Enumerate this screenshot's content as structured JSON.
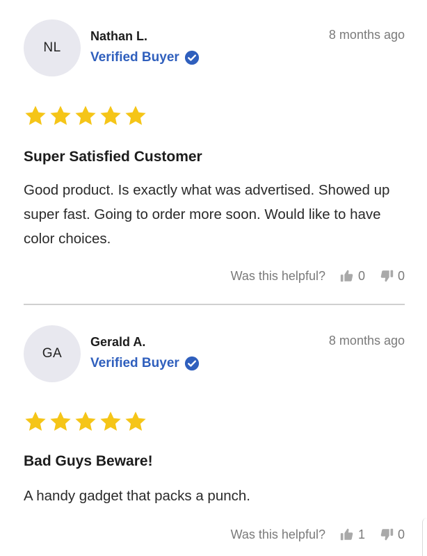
{
  "reviews": [
    {
      "initials": "NL",
      "name": "Nathan L.",
      "verified_label": "Verified Buyer",
      "time": "8 months ago",
      "rating": 5,
      "title": "Super Satisfied Customer",
      "body": "Good product. Is exactly what was advertised. Showed up super fast. Going to order more soon. Would like to have color choices.",
      "helpful_label": "Was this helpful?",
      "upvotes": "0",
      "downvotes": "0"
    },
    {
      "initials": "GA",
      "name": "Gerald A.",
      "verified_label": "Verified Buyer",
      "time": "8 months ago",
      "rating": 5,
      "title": "Bad Guys Beware!",
      "body": "A handy gadget that packs a punch.",
      "helpful_label": "Was this helpful?",
      "upvotes": "1",
      "downvotes": "0"
    }
  ],
  "colors": {
    "star": "#f5c518",
    "verified": "#2f5fbd",
    "avatar_bg": "#e8e8ef",
    "muted_text": "#7a7a7a",
    "thumb": "#a9a9a9"
  },
  "icons": {
    "verified": "check-badge-icon",
    "rating": "star-icon",
    "upvote": "thumbs-up-icon",
    "downvote": "thumbs-down-icon"
  }
}
